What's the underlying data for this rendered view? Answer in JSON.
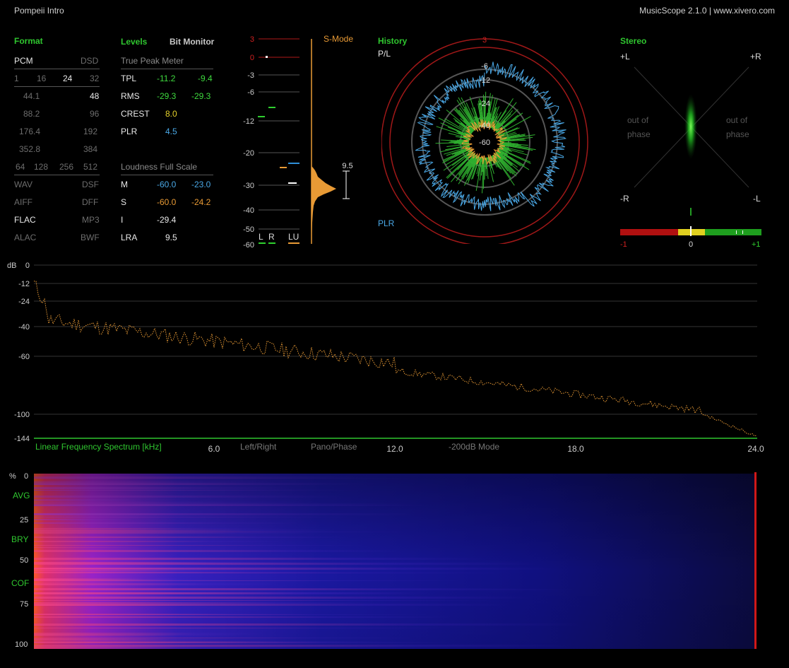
{
  "window": {
    "title": "Pompeii Intro",
    "app": "MusicScope 2.1.0 | www.xivero.com"
  },
  "format": {
    "title": "Format",
    "pcm": "PCM",
    "dsd": "DSD",
    "bits": [
      "1",
      "16",
      "24",
      "32"
    ],
    "rates": [
      {
        "pcm": "44.1",
        "dsd": "48"
      },
      {
        "pcm": "88.2",
        "dsd": "96"
      },
      {
        "pcm": "176.4",
        "dsd": "192"
      },
      {
        "pcm": "352.8",
        "dsd": "384"
      }
    ],
    "dsd_rates": [
      "64",
      "128",
      "256",
      "512"
    ],
    "files": [
      {
        "left": "WAV",
        "right": "DSF"
      },
      {
        "left": "AIFF",
        "right": "DFF"
      },
      {
        "left": "FLAC",
        "right": "MP3"
      },
      {
        "left": "ALAC",
        "right": "BWF"
      }
    ]
  },
  "levels": {
    "title": "Levels",
    "bit_monitor": "Bit Monitor",
    "tpm_header": "True Peak Meter",
    "tpm_rows": [
      {
        "label": "TPL",
        "l": "-11.2",
        "r": "-9.4"
      },
      {
        "label": "RMS",
        "l": "-29.3",
        "r": "-29.3"
      }
    ],
    "crest": {
      "label": "CREST",
      "value": "8.0"
    },
    "plr": {
      "label": "PLR",
      "value": "4.5"
    },
    "loud_header": "Loudness Full Scale",
    "m": {
      "label": "M",
      "a": "-60.0",
      "b": "-23.0"
    },
    "s": {
      "label": "S",
      "a": "-60.0",
      "b": "-24.2"
    },
    "i": {
      "label": "I",
      "value": "-29.4"
    },
    "lra": {
      "label": "LRA",
      "value": "9.5"
    }
  },
  "meter": {
    "scale": [
      "3",
      "0",
      "-3",
      "-6",
      "-12",
      "-20",
      "-30",
      "-40",
      "-50",
      "-60"
    ],
    "smode": "S-Mode",
    "lra_value": "9.5",
    "ch_l": "L",
    "ch_r": "R",
    "ch_lu": "LU"
  },
  "history": {
    "title": "History",
    "pl": "P/L",
    "plr": "PLR",
    "rings": [
      "3",
      "-6",
      "-12",
      "-24",
      "-40",
      "-60"
    ]
  },
  "stereo": {
    "title": "Stereo",
    "pl": "+L",
    "pr": "+R",
    "mr": "-R",
    "ml": "-L",
    "oop_left": [
      "out of",
      "phase"
    ],
    "oop_right": [
      "out of",
      "phase"
    ],
    "corr": [
      "-1",
      "0",
      "+1"
    ]
  },
  "spectrum": {
    "db": "dB",
    "yticks": [
      "0",
      "-12",
      "-24",
      "-40",
      "-60",
      "-100",
      "-144"
    ],
    "xlabel": "Linear Frequency Spectrum [kHz]",
    "xticks": [
      "6.0",
      "12.0",
      "18.0",
      "24.0"
    ],
    "buttons": [
      "Left/Right",
      "Pano/Phase",
      "-200dB Mode"
    ]
  },
  "sonogram": {
    "yticks": [
      "%",
      "0",
      "AVG",
      "25",
      "BRY",
      "50",
      "COF",
      "75",
      "100"
    ]
  },
  "colors": {
    "accent_green": "#2fc62f",
    "meter_orange": "#e89a35",
    "blue": "#4aa8e6",
    "red": "#c01818",
    "yellow": "#e6d22a"
  }
}
